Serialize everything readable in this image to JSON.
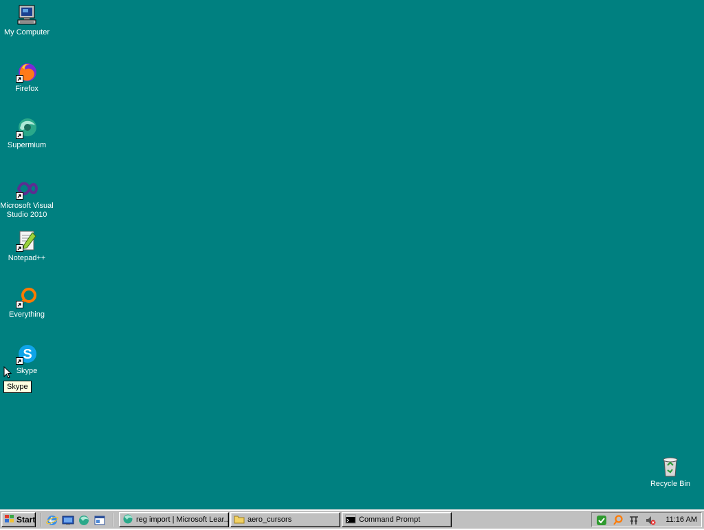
{
  "desktop": {
    "background": "#008080",
    "icons": [
      {
        "label": "My Computer",
        "icon": "my-computer-icon"
      },
      {
        "label": "Firefox",
        "icon": "firefox-icon"
      },
      {
        "label": "Supermium",
        "icon": "supermium-icon"
      },
      {
        "label": "Microsoft Visual\nStudio 2010",
        "icon": "visual-studio-icon"
      },
      {
        "label": "Notepad++",
        "icon": "notepad-plus-plus-icon"
      },
      {
        "label": "Everything",
        "icon": "everything-icon"
      },
      {
        "label": "Skype",
        "icon": "skype-icon"
      },
      {
        "label": "Recycle Bin",
        "icon": "recycle-bin-icon"
      }
    ],
    "tooltip": "Skype"
  },
  "taskbar": {
    "start_label": "Start",
    "quick_launch": [
      "internet-explorer-icon",
      "show-desktop-icon",
      "supermium-icon",
      "explorer-icon"
    ],
    "tasks": [
      {
        "label": "reg import | Microsoft Lear...",
        "icon": "supermium-icon"
      },
      {
        "label": "aero_cursors",
        "icon": "folder-icon"
      },
      {
        "label": "Command Prompt",
        "icon": "command-prompt-icon"
      }
    ],
    "tray_icons": [
      "security-check-icon",
      "search-icon",
      "input-method-icon",
      "volume-muted-icon"
    ],
    "clock": "11:16 AM"
  }
}
